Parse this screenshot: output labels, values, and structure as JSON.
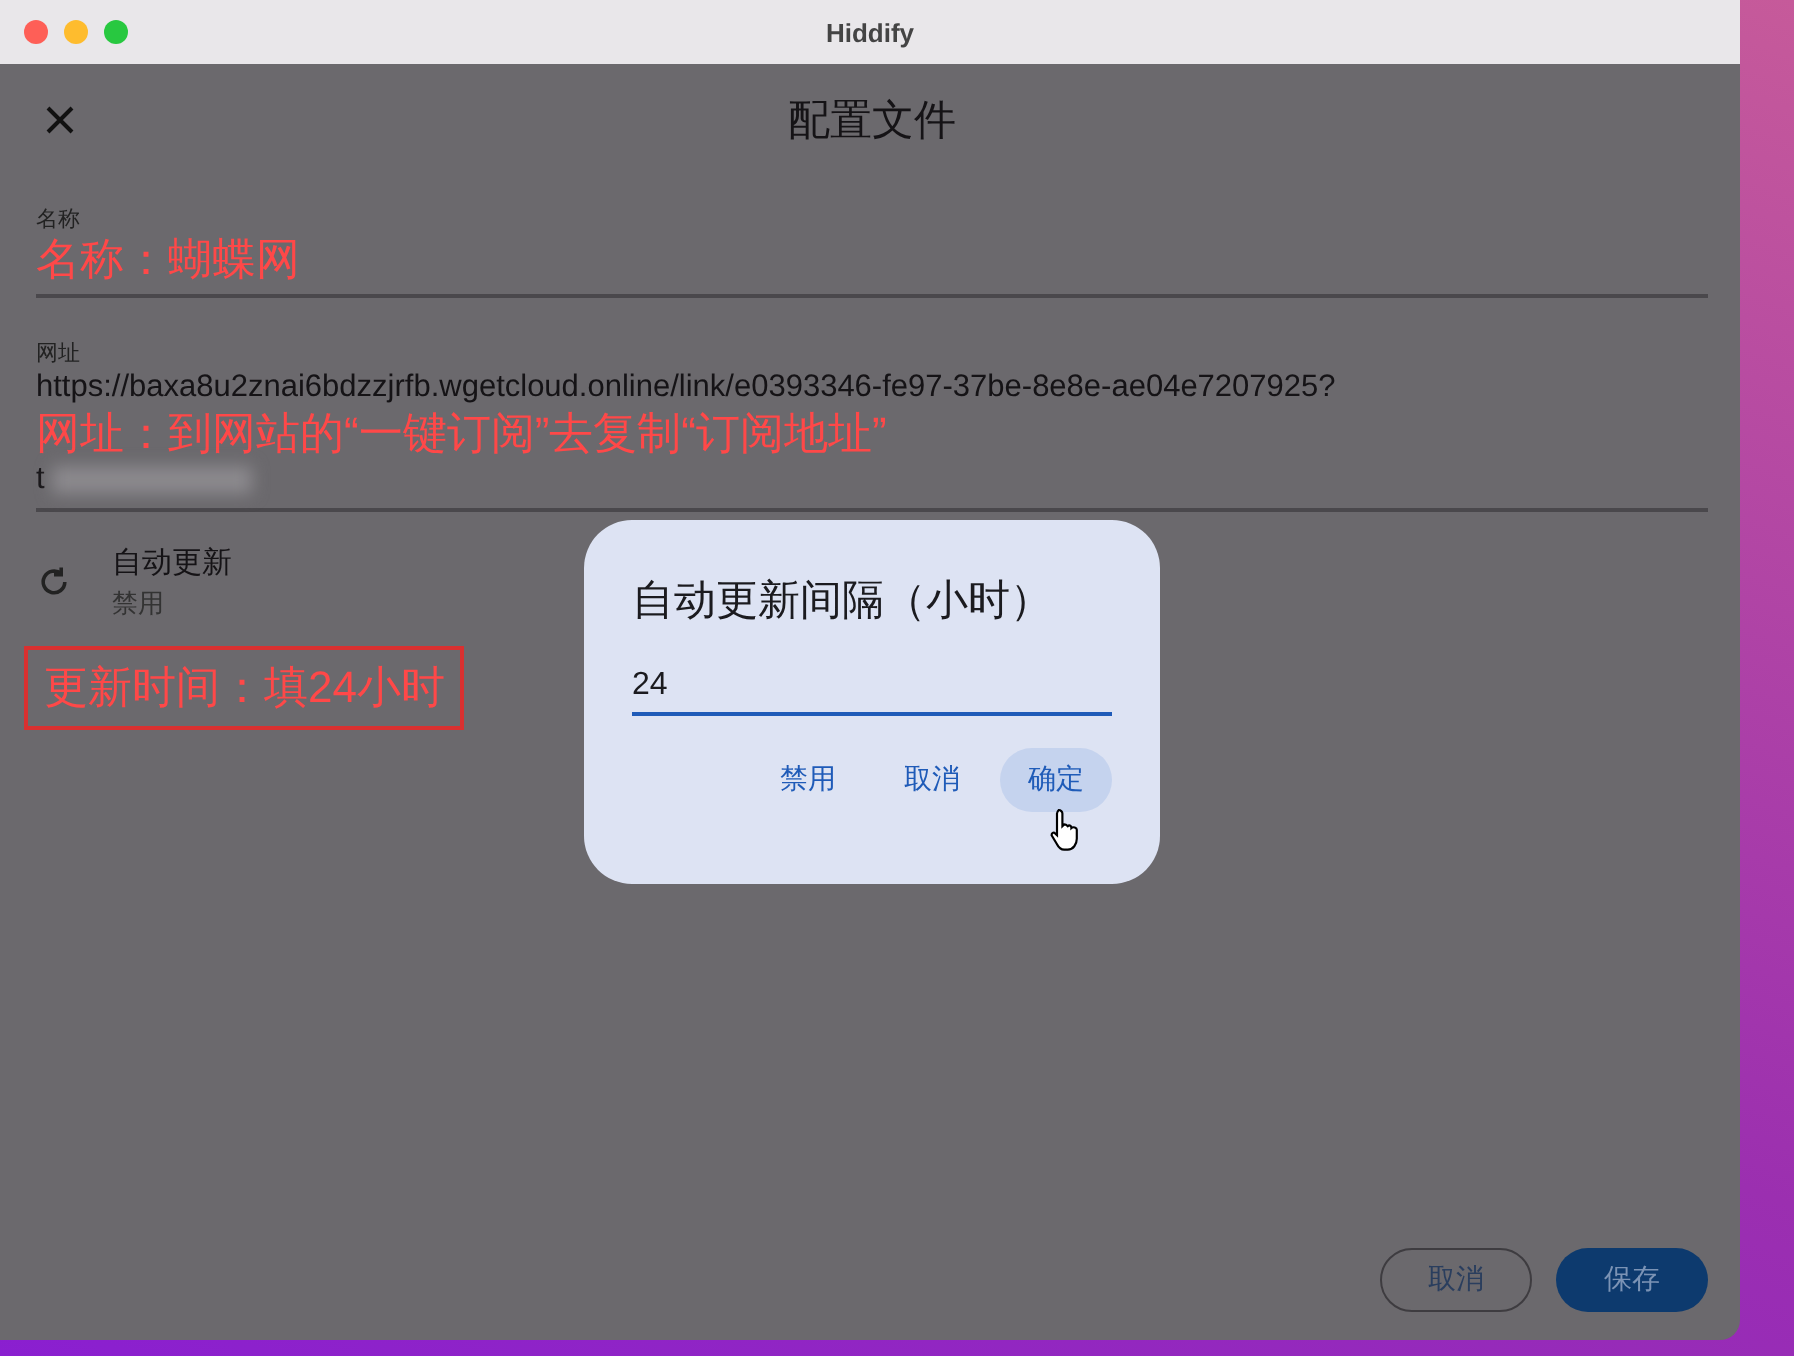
{
  "window": {
    "title": "Hiddify"
  },
  "page": {
    "title": "配置文件"
  },
  "fields": [
    {
      "label": "名称"
    },
    {
      "label": "网址",
      "value_lines": [
        "https://baxa8u2znai6bdzzjrfb.wgetcloud.online/link/e0393346-fe97-37be-8e8e-ae04e7207925?",
        "t"
      ]
    }
  ],
  "auto_update": {
    "title": "自动更新",
    "subtitle": "禁用"
  },
  "dialog": {
    "title": "自动更新间隔（小时）",
    "value": "24",
    "buttons": [
      {
        "label": "禁用",
        "hovered": false
      },
      {
        "label": "取消",
        "hovered": false
      },
      {
        "label": "确定",
        "hovered": true
      }
    ]
  },
  "footer_buttons": [
    {
      "label": "取消",
      "kind": "outlined"
    },
    {
      "label": "保存",
      "kind": "filled"
    }
  ],
  "annotations": [
    {
      "text": "名称：蝴蝶网",
      "boxed": false
    },
    {
      "text": "网址：到网站的“一键订阅”去复制“订阅地址”",
      "boxed": false
    },
    {
      "text": "更新时间：填24小时",
      "boxed": true
    }
  ]
}
